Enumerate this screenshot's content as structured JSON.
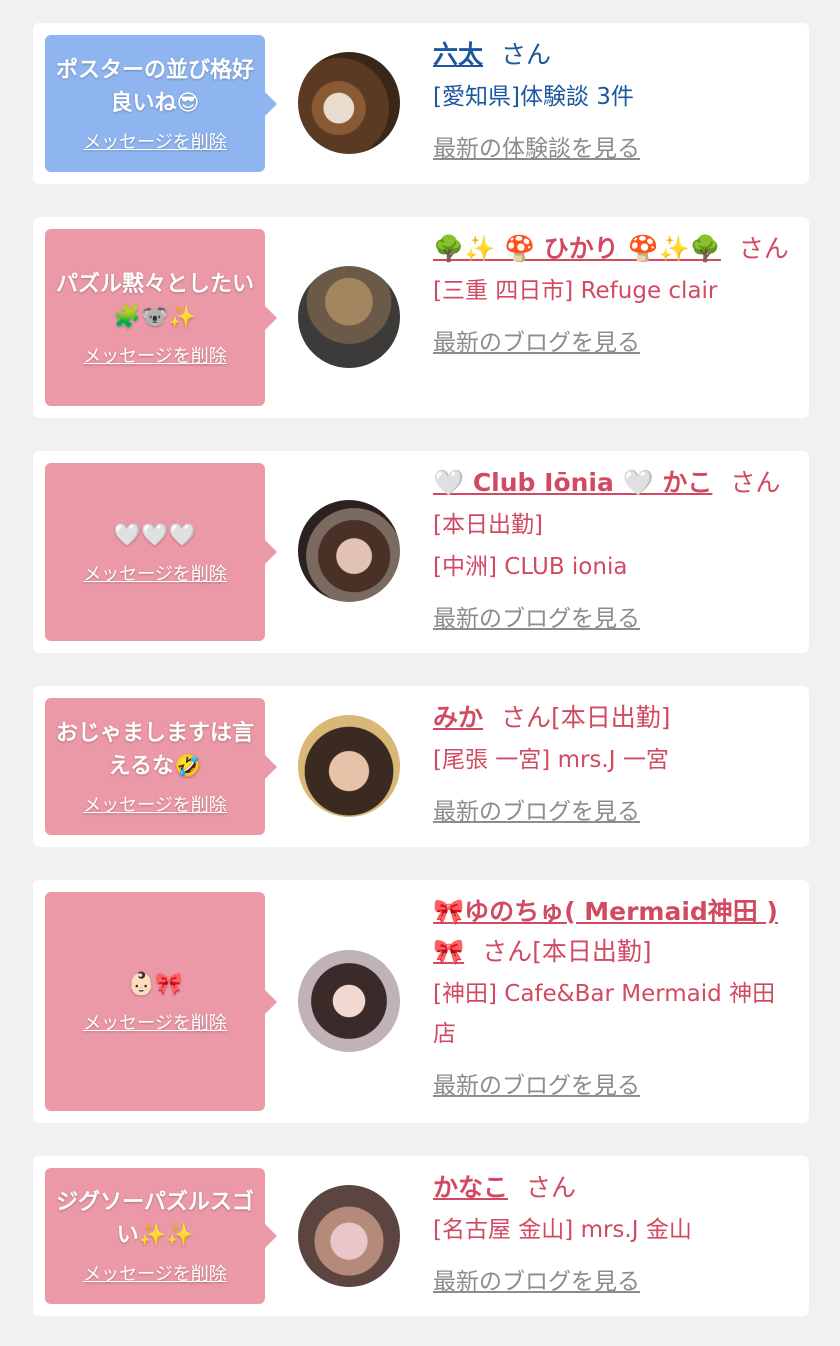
{
  "common": {
    "delete_label": "メッセージを削除",
    "honorific": "さん"
  },
  "colors": {
    "blue_bubble": "#8fb5f0",
    "pink_bubble": "#eb99a6",
    "blue_text": "#1e56a0",
    "pink_text": "#d24a62",
    "link_gray": "#8c8c8c"
  },
  "cards": [
    {
      "message": "ポスターの並び格好良いね😎",
      "name": "六太",
      "suffix": "",
      "meta": [
        "[愛知県]体験談 3件"
      ],
      "more_link": "最新の体験談を見る"
    },
    {
      "message": "パズル黙々としたい🧩🐨✨",
      "name": "🌳✨ 🍄 ひかり 🍄✨🌳",
      "suffix": "",
      "meta": [
        "[三重 四日市] Refuge clair"
      ],
      "more_link": "最新のブログを見る"
    },
    {
      "message": "🤍🤍🤍",
      "name": "🤍 Club Iōnia 🤍 かこ",
      "suffix": "",
      "meta": [
        "[本日出勤]",
        "[中洲] CLUB ionia"
      ],
      "more_link": "最新のブログを見る"
    },
    {
      "message": "おじゃましますは言えるな🤣",
      "name": "みか",
      "suffix": "[本日出勤]",
      "meta": [
        "[尾張 一宮] mrs.J 一宮"
      ],
      "more_link": "最新のブログを見る"
    },
    {
      "message": "👶🏻🎀",
      "name": "🎀ゆのちゅ( Mermaid神田 )🎀",
      "suffix": "[本日出勤]",
      "meta": [
        "[神田] Cafe&Bar Mermaid 神田店"
      ],
      "more_link": "最新のブログを見る"
    },
    {
      "message": "ジグソーパズルスゴい✨✨",
      "name": "かなこ",
      "suffix": "",
      "meta": [
        "[名古屋 金山] mrs.J 金山"
      ],
      "more_link": "最新のブログを見る"
    }
  ]
}
